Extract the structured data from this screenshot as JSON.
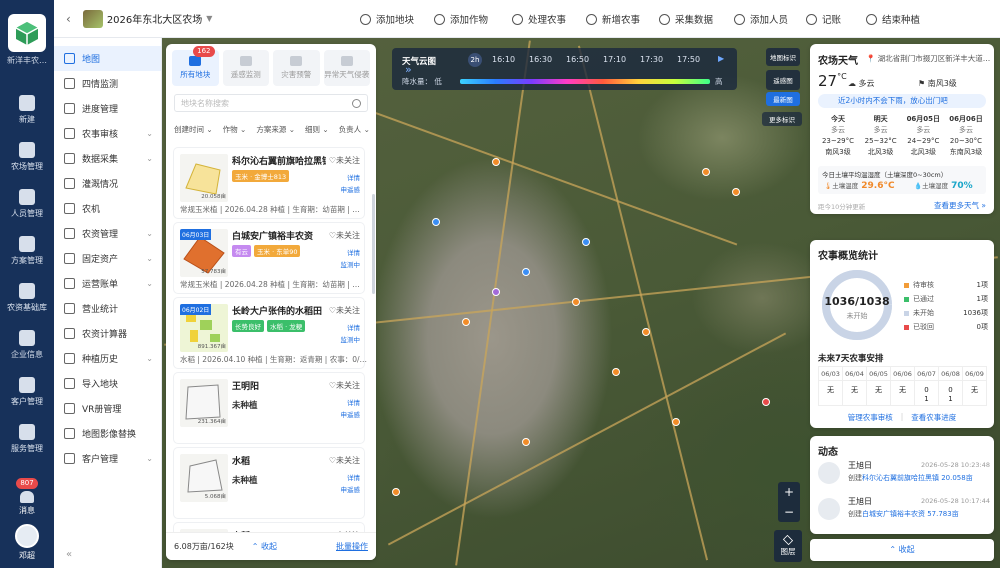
{
  "rail": {
    "farm_short": "新洋丰农…",
    "items": [
      {
        "label": "新建",
        "icon": "plus-circle-icon"
      },
      {
        "label": "农场管理",
        "icon": "farm-icon"
      },
      {
        "label": "人员管理",
        "icon": "person-icon"
      },
      {
        "label": "方案管理",
        "icon": "plan-icon"
      },
      {
        "label": "农资基础库",
        "icon": "house-icon"
      },
      {
        "label": "企业信息",
        "icon": "building-icon"
      },
      {
        "label": "客户管理",
        "icon": "customer-icon"
      },
      {
        "label": "服务管理",
        "icon": "service-icon"
      }
    ],
    "messages": {
      "label": "消息",
      "badge": "807"
    },
    "user": {
      "name": "邓超"
    }
  },
  "sidebar": {
    "items": [
      {
        "label": "地图",
        "active": true
      },
      {
        "label": "四情监测"
      },
      {
        "label": "进度管理"
      },
      {
        "label": "农事审核",
        "chevron": true
      },
      {
        "label": "数据采集",
        "chevron": true
      },
      {
        "label": "灌溉情况"
      },
      {
        "label": "农机"
      },
      {
        "label": "农资管理",
        "chevron": true
      },
      {
        "label": "固定资产",
        "chevron": true
      },
      {
        "label": "运营账单",
        "chevron": true
      },
      {
        "label": "营业统计"
      },
      {
        "label": "农资计算器"
      },
      {
        "label": "种植历史",
        "chevron": true
      },
      {
        "label": "导入地块"
      },
      {
        "label": "VR册管理"
      },
      {
        "label": "地图影像替换"
      },
      {
        "label": "客户管理",
        "chevron": true
      }
    ]
  },
  "topbar": {
    "farm_title": "2026年东北大区农场",
    "actions": [
      "添加地块",
      "添加作物",
      "处理农事",
      "新增农事",
      "采集数据",
      "添加人员",
      "记账",
      "结束种植"
    ]
  },
  "weather_bar": {
    "title": "天气云图",
    "mode": "2h",
    "times": [
      "16:10",
      "16:30",
      "16:50",
      "17:10",
      "17:30",
      "17:50"
    ],
    "rain_label": "降水量：",
    "low": "低",
    "high": "高"
  },
  "map_controls": {
    "ctl1": "地图标识",
    "ctl2": "遥感图",
    "ctl3": "最新图",
    "more": "更多标识",
    "layers": "图层",
    "zoom_in": "+",
    "zoom_out": "−"
  },
  "plots": {
    "tabs": [
      {
        "label": "所有地块",
        "badge": "162",
        "active": true
      },
      {
        "label": "遥感监测"
      },
      {
        "label": "灾害预警"
      },
      {
        "label": "异常天气侵袭"
      }
    ],
    "search_placeholder": "地块名称搜索",
    "filters": [
      "创建时间 ⌄",
      "作物 ⌄",
      "方案来源 ⌄",
      "细则 ⌄",
      "负责人 ⌄"
    ],
    "cards": [
      {
        "name": "科尔沁右翼前旗哈拉黑镇",
        "follow": "♡未关注",
        "tags": [
          {
            "text": "玉米 · 金博士813",
            "color": "#f2a93b"
          }
        ],
        "side": [
          "详情",
          "申遥感"
        ],
        "info": "常规玉米植 | 2026.04.28 种植 | 生育期：幼苗期 | …",
        "size": "20.058亩",
        "shape": "yellow",
        "date": ""
      },
      {
        "name": "白城安广镇裕丰农资",
        "follow": "♡未关注",
        "tags": [
          {
            "text": "有云",
            "color": "#c58af0"
          },
          {
            "text": "玉米 · 东单90",
            "color": "#f2a93b"
          }
        ],
        "side": [
          "详情",
          "监测中"
        ],
        "info": "常规玉米植 | 2026.04.28 种植 | 生育期：幼苗期 | …",
        "size": "57.783亩",
        "shape": "orange",
        "date": "06月03日"
      },
      {
        "name": "长岭大户张伟的水稻田",
        "follow": "♡未关注",
        "tags": [
          {
            "text": "长势良好",
            "color": "#3bbf6a"
          },
          {
            "text": "水稻 · 龙粳",
            "color": "#3bbf6a"
          }
        ],
        "side": [
          "详情",
          "监测中"
        ],
        "info": "水稻 | 2026.04.10 种植 | 生育期：返青期 | 农事：0/…",
        "size": "891.367亩",
        "shape": "map",
        "date": "06月02日"
      },
      {
        "name": "王明阳",
        "follow": "♡未关注",
        "status": "未种植",
        "side": [
          "详情",
          "申遥感"
        ],
        "size": "231.364亩",
        "shape": "gray"
      },
      {
        "name": "水稻",
        "follow": "♡未关注",
        "status": "未种植",
        "side": [
          "详情",
          "申遥感"
        ],
        "size": "5.068亩",
        "shape": "gray2"
      },
      {
        "name": "小稻",
        "follow": "♡未关注",
        "status": "",
        "side": [],
        "size": "",
        "shape": "gray"
      }
    ],
    "footer": {
      "total": "6.08万亩/162块",
      "collapse": "⌃ 收起",
      "batch": "批量操作"
    }
  },
  "weather": {
    "title": "农场天气",
    "location": "湖北省荆门市掇刀区新洋丰大道…",
    "temp": "27",
    "unit": "°C",
    "cond": "多云",
    "wind": "南风3级",
    "alert": "近2小时内不会下雨，放心出门吧",
    "days": [
      {
        "name": "今天",
        "cond": "多云",
        "range": "23~29°C",
        "wind": "南风3级"
      },
      {
        "name": "明天",
        "cond": "多云",
        "range": "25~32°C",
        "wind": "北风3级"
      },
      {
        "name": "06月05日",
        "cond": "多云",
        "range": "24~29°C",
        "wind": "北风3级"
      },
      {
        "name": "06月06日",
        "cond": "多云",
        "range": "20~30°C",
        "wind": "东南风3级"
      }
    ],
    "soil_title": "今日土壤平均温湿度（土壤深度0~30cm）",
    "soil_temp_label": "土壤温度",
    "soil_temp": "29.6°C",
    "soil_hum_label": "土壤湿度",
    "soil_hum": "70%",
    "refresh": "距今10分钟更新",
    "more": "查看更多天气 »"
  },
  "stats": {
    "title": "农事概览统计",
    "count": "1036/1038",
    "count_sub": "未开始",
    "legend": [
      {
        "label": "待审核",
        "value": "1项",
        "color": "#f29c38"
      },
      {
        "label": "已通过",
        "value": "1项",
        "color": "#3bbf6a"
      },
      {
        "label": "未开始",
        "value": "1036项",
        "color": "#c9d4e6"
      },
      {
        "label": "已驳回",
        "value": "0项",
        "color": "#e84a4a"
      }
    ],
    "week_title": "未来7天农事安排",
    "days": [
      {
        "date": "06/03",
        "value": "无"
      },
      {
        "date": "06/04",
        "value": "无"
      },
      {
        "date": "06/05",
        "value": "无"
      },
      {
        "date": "06/06",
        "value": "无"
      },
      {
        "date": "06/07",
        "value": "0\n1"
      },
      {
        "date": "06/08",
        "value": "0\n1"
      },
      {
        "date": "06/09",
        "value": "无"
      }
    ],
    "link1": "管理农事审核",
    "link2": "查看农事进度"
  },
  "feed": {
    "title": "动态",
    "items": [
      {
        "name": "王旭日",
        "time": "2026-05-28 10:23:48",
        "prefix": "创建",
        "hl": "科尔沁右翼前旗哈拉黑镇 20.058亩"
      },
      {
        "name": "王旭日",
        "time": "2026-05-28 10:17:44",
        "prefix": "创建",
        "hl": "白城安广镇裕丰农资 57.783亩"
      }
    ],
    "collapse": "⌃ 收起"
  }
}
